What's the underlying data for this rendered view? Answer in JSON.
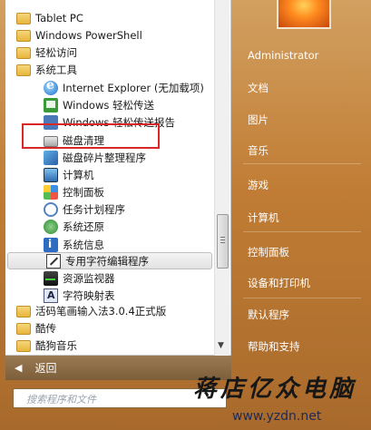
{
  "programs": [
    {
      "label": "Tablet PC",
      "level": 0,
      "icon": "folder-icon",
      "selected": false
    },
    {
      "label": "Windows PowerShell",
      "level": 0,
      "icon": "folder-icon",
      "selected": false
    },
    {
      "label": "轻松访问",
      "level": 0,
      "icon": "folder-icon",
      "selected": false
    },
    {
      "label": "系统工具",
      "level": 0,
      "icon": "folder-icon",
      "selected": false
    },
    {
      "label": "Internet Explorer (无加载项)",
      "level": 2,
      "icon": "ie-icon",
      "selected": false
    },
    {
      "label": "Windows 轻松传送",
      "level": 2,
      "icon": "easy-icon",
      "selected": false
    },
    {
      "label": "Windows 轻松传送报告",
      "level": 2,
      "icon": "easy-report-icon",
      "selected": false
    },
    {
      "label": "磁盘清理",
      "level": 2,
      "icon": "disk-icon",
      "selected": false
    },
    {
      "label": "磁盘碎片整理程序",
      "level": 2,
      "icon": "defrag-icon",
      "selected": false
    },
    {
      "label": "计算机",
      "level": 2,
      "icon": "computer-icon",
      "selected": false
    },
    {
      "label": "控制面板",
      "level": 2,
      "icon": "control-panel-icon",
      "selected": false
    },
    {
      "label": "任务计划程序",
      "level": 2,
      "icon": "task-scheduler-icon",
      "selected": false
    },
    {
      "label": "系统还原",
      "level": 2,
      "icon": "restore-icon",
      "selected": false
    },
    {
      "label": "系统信息",
      "level": 2,
      "icon": "sysinfo-icon",
      "selected": false
    },
    {
      "label": "专用字符编辑程序",
      "level": 2,
      "icon": "charedit-icon",
      "selected": true
    },
    {
      "label": "资源监视器",
      "level": 2,
      "icon": "resmon-icon",
      "selected": false
    },
    {
      "label": "字符映射表",
      "level": 2,
      "icon": "charmap-icon",
      "selected": false
    },
    {
      "label": "活码笔画输入法3.0.4正式版",
      "level": 0,
      "icon": "folder-icon",
      "selected": false
    },
    {
      "label": "酷传",
      "level": 0,
      "icon": "folder-icon",
      "selected": false
    },
    {
      "label": "酷狗音乐",
      "level": 0,
      "icon": "folder-icon",
      "selected": false
    }
  ],
  "back": {
    "label": "返回",
    "arrow": "◀"
  },
  "search": {
    "placeholder": "搜索程序和文件"
  },
  "right_menu": [
    "Administrator",
    "文档",
    "图片",
    "音乐",
    "游戏",
    "计算机",
    "控制面板",
    "设备和打印机",
    "默认程序",
    "帮助和支持"
  ],
  "scrollbar": {
    "grip": "≡",
    "down_arrow": "▼"
  },
  "watermark": {
    "text": "蒋店亿众电脑",
    "url": "www.yzdn.net"
  },
  "colors": {
    "highlight": "#d92626",
    "menu_bg": "#c07c34",
    "panel_bg": "#ffffff"
  }
}
